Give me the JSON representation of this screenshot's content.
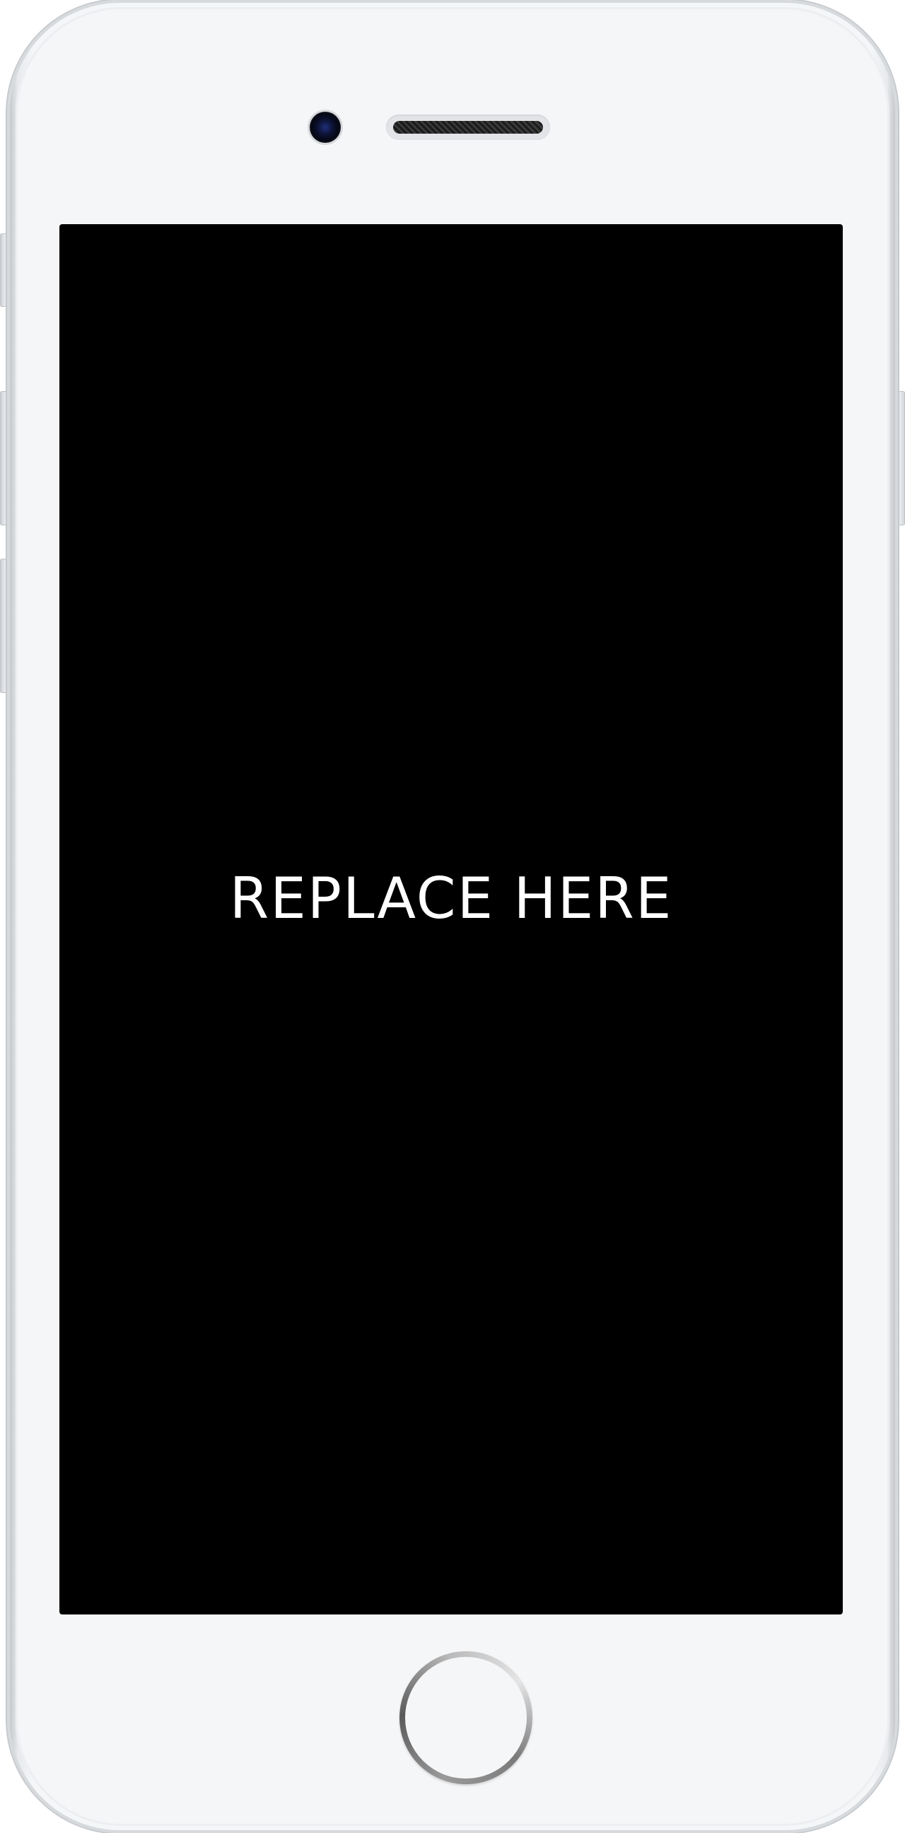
{
  "device": {
    "model": "smartphone-mockup",
    "frame_color": "#f5f6f8",
    "screen_color": "#000000"
  },
  "screen": {
    "placeholder_text": "REPLACE HERE",
    "text_color": "#ffffff"
  },
  "icons": {
    "front_camera": "camera-icon",
    "earpiece": "speaker-icon",
    "home_button": "home-button-icon"
  }
}
